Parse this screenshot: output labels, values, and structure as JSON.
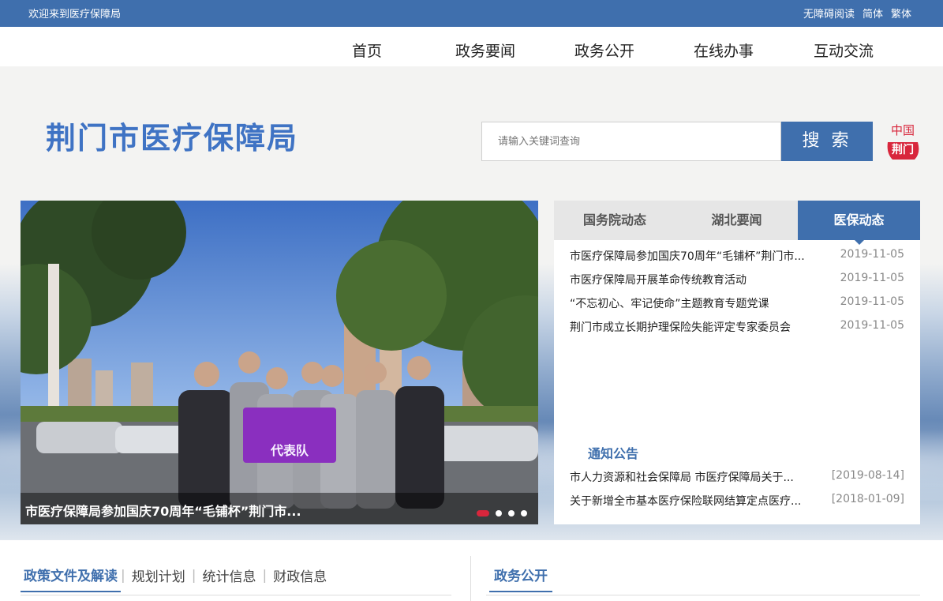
{
  "topbar": {
    "welcome": "欢迎来到医疗保障局",
    "links": [
      "无障碍阅读",
      "简体",
      "繁体"
    ]
  },
  "nav": {
    "items": [
      "首页",
      "政务要闻",
      "政务公开",
      "在线办事",
      "互动交流"
    ]
  },
  "header": {
    "site_title": "荆门市医疗保障局",
    "search_placeholder": "请输入关键词查询",
    "search_button": "搜 索",
    "logo_text_top": "中国",
    "logo_text_bottom": "荆门"
  },
  "slider": {
    "caption": "市医疗保障局参加国庆70周年“毛铺杯”荆门市...",
    "banner_text": "代表队",
    "slide_count": 4,
    "active_slide": 1
  },
  "news": {
    "tabs": [
      "国务院动态",
      "湖北要闻",
      "医保动态"
    ],
    "active_tab": "医保动态",
    "items": [
      {
        "title": "市医疗保障局参加国庆70周年“毛铺杯”荆门市...",
        "date": "2019-11-05"
      },
      {
        "title": "市医疗保障局开展革命传统教育活动",
        "date": "2019-11-05"
      },
      {
        "title": "“不忘初心、牢记使命”主题教育专题党课",
        "date": "2019-11-05"
      },
      {
        "title": "荆门市成立长期护理保险失能评定专家委员会",
        "date": "2019-11-05"
      }
    ]
  },
  "notice": {
    "title": "通知公告",
    "items": [
      {
        "title": "市人力资源和社会保障局 市医疗保障局关于...",
        "date": "[2019-08-14]"
      },
      {
        "title": "关于新增全市基本医疗保险联网结算定点医疗...",
        "date": "[2018-01-09]"
      }
    ]
  },
  "sections": {
    "left_main": "政策文件及解读",
    "left_subs": [
      "规划计划",
      "统计信息",
      "财政信息"
    ],
    "right_main": "政务公开"
  },
  "colors": {
    "brand_blue": "#3f6fad",
    "title_blue": "#3f73c4",
    "dot_active": "#d8263c"
  }
}
